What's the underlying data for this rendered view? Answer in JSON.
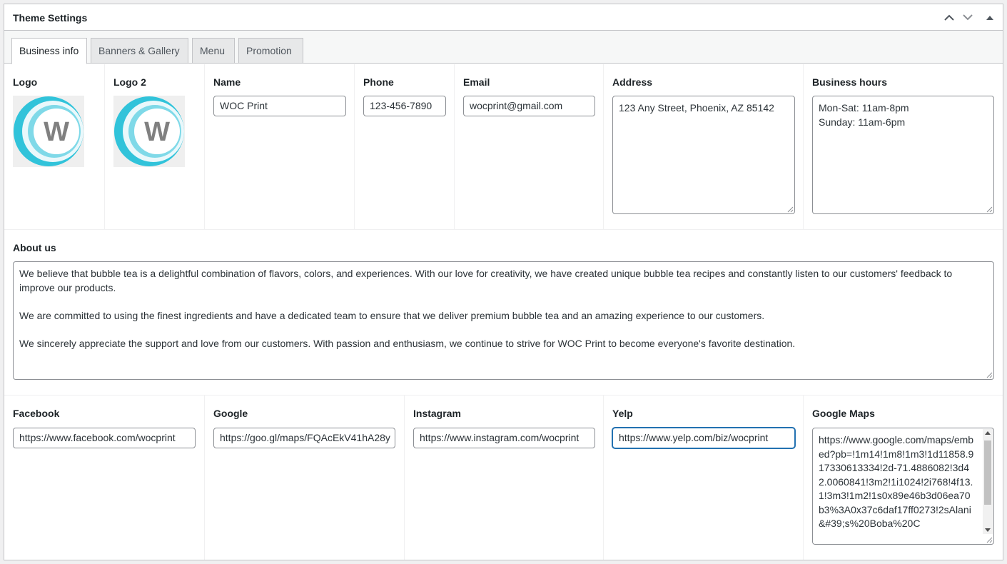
{
  "header": {
    "title": "Theme Settings"
  },
  "tabs": [
    {
      "label": "Business info"
    },
    {
      "label": "Banners & Gallery"
    },
    {
      "label": "Menu"
    },
    {
      "label": "Promotion"
    }
  ],
  "business": {
    "logo_label": "Logo",
    "logo2_label": "Logo 2",
    "logo_letter": "W",
    "name_label": "Name",
    "name_value": "WOC Print",
    "phone_label": "Phone",
    "phone_value": "123-456-7890",
    "email_label": "Email",
    "email_value": "wocprint@gmail.com",
    "address_label": "Address",
    "address_value": "123 Any Street, Phoenix, AZ 85142",
    "hours_label": "Business hours",
    "hours_value": "Mon-Sat: 11am-8pm\nSunday: 11am-6pm"
  },
  "about": {
    "label": "About us",
    "value": "We believe that bubble tea is a delightful combination of flavors, colors, and experiences. With our love for creativity, we have created unique bubble tea recipes and constantly listen to our customers' feedback to improve our products.\n\nWe are committed to using the finest ingredients and have a dedicated team to ensure that we deliver premium bubble tea and an amazing experience to our customers.\n\nWe sincerely appreciate the support and love from our customers. With passion and enthusiasm, we continue to strive for WOC Print to become everyone's favorite destination."
  },
  "social": {
    "facebook_label": "Facebook",
    "facebook_value": "https://www.facebook.com/wocprint",
    "google_label": "Google",
    "google_value": "https://goo.gl/maps/FQAcEkV41hA28y",
    "instagram_label": "Instagram",
    "instagram_value": "https://www.instagram.com/wocprint",
    "yelp_label": "Yelp",
    "yelp_value": "https://www.yelp.com/biz/wocprint",
    "maps_label": "Google Maps",
    "maps_value": "https://www.google.com/maps/embed?pb=!1m14!1m8!1m3!1d11858.917330613334!2d-71.4886082!3d42.0060841!3m2!1i1024!2i768!4f13.1!3m3!1m2!1s0x89e46b3d06ea70b3%3A0x37c6daf17ff0273!2sAlani&#39;s%20Boba%20C"
  },
  "colors": {
    "accent": "#2271b1",
    "logo_teal": "#31c3da",
    "logo_grey": "#808080"
  }
}
